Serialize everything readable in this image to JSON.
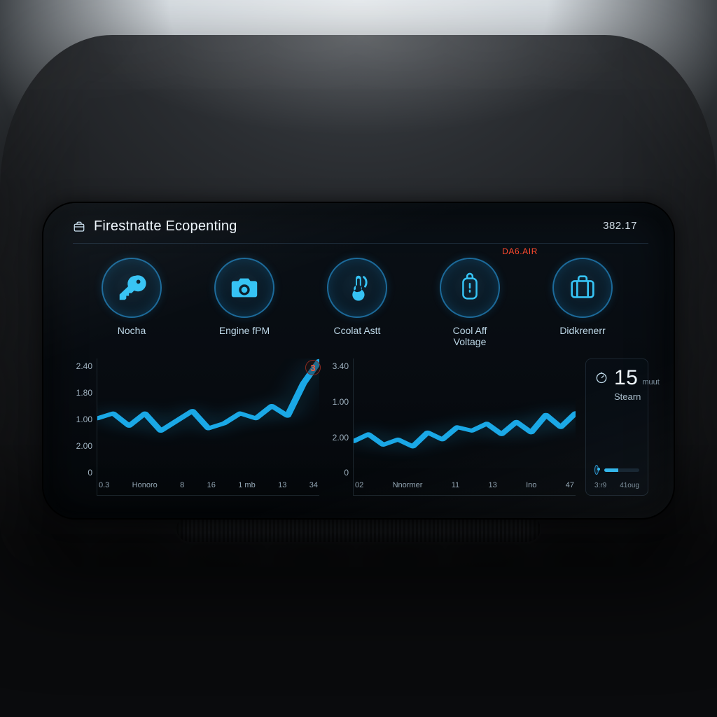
{
  "header": {
    "title": "Firestnatte Ecopenting",
    "time": "382.17"
  },
  "alert_tag": "DA6.AIR",
  "icons": [
    {
      "name": "key-icon",
      "label": "Nocha"
    },
    {
      "name": "camera-icon",
      "label": "Engine fPM"
    },
    {
      "name": "temp-icon",
      "label": "Ccolat Astt"
    },
    {
      "name": "battery-icon",
      "label": "Cool Aff\nVoltage"
    },
    {
      "name": "case-icon",
      "label": "Didkrenerr"
    }
  ],
  "chart_data": [
    {
      "type": "line",
      "ylim": [
        0,
        2.4
      ],
      "y_ticks": [
        "2.40",
        "1.80",
        "1.00",
        "2.00",
        "0"
      ],
      "x_ticks": [
        "0.3",
        "Honoro",
        "8",
        "16",
        "1 mb",
        "13",
        "34"
      ],
      "x": [
        0,
        1,
        2,
        3,
        4,
        5,
        6,
        7,
        8,
        9,
        10,
        11,
        12,
        13,
        14
      ],
      "values": [
        1.2,
        1.3,
        1.05,
        1.3,
        0.95,
        1.15,
        1.35,
        1.0,
        1.1,
        1.3,
        1.2,
        1.45,
        1.25,
        1.9,
        2.35
      ],
      "badge": "3"
    },
    {
      "type": "line",
      "ylim": [
        0,
        3.4
      ],
      "y_ticks": [
        "3.40",
        "1.00",
        "2.00",
        "0"
      ],
      "x_ticks": [
        "02",
        "Nnormer",
        "11",
        "13",
        "Ino",
        "47"
      ],
      "x": [
        0,
        1,
        2,
        3,
        4,
        5,
        6,
        7,
        8,
        9,
        10,
        11,
        12,
        13,
        14,
        15
      ],
      "values": [
        1.05,
        1.25,
        0.95,
        1.1,
        0.9,
        1.3,
        1.1,
        1.45,
        1.35,
        1.55,
        1.25,
        1.6,
        1.3,
        1.8,
        1.45,
        1.85
      ]
    }
  ],
  "side_card": {
    "value": "15",
    "unit": "muut",
    "sub": "Stearn",
    "x_ticks": [
      "3:r9",
      "41oug"
    ]
  }
}
